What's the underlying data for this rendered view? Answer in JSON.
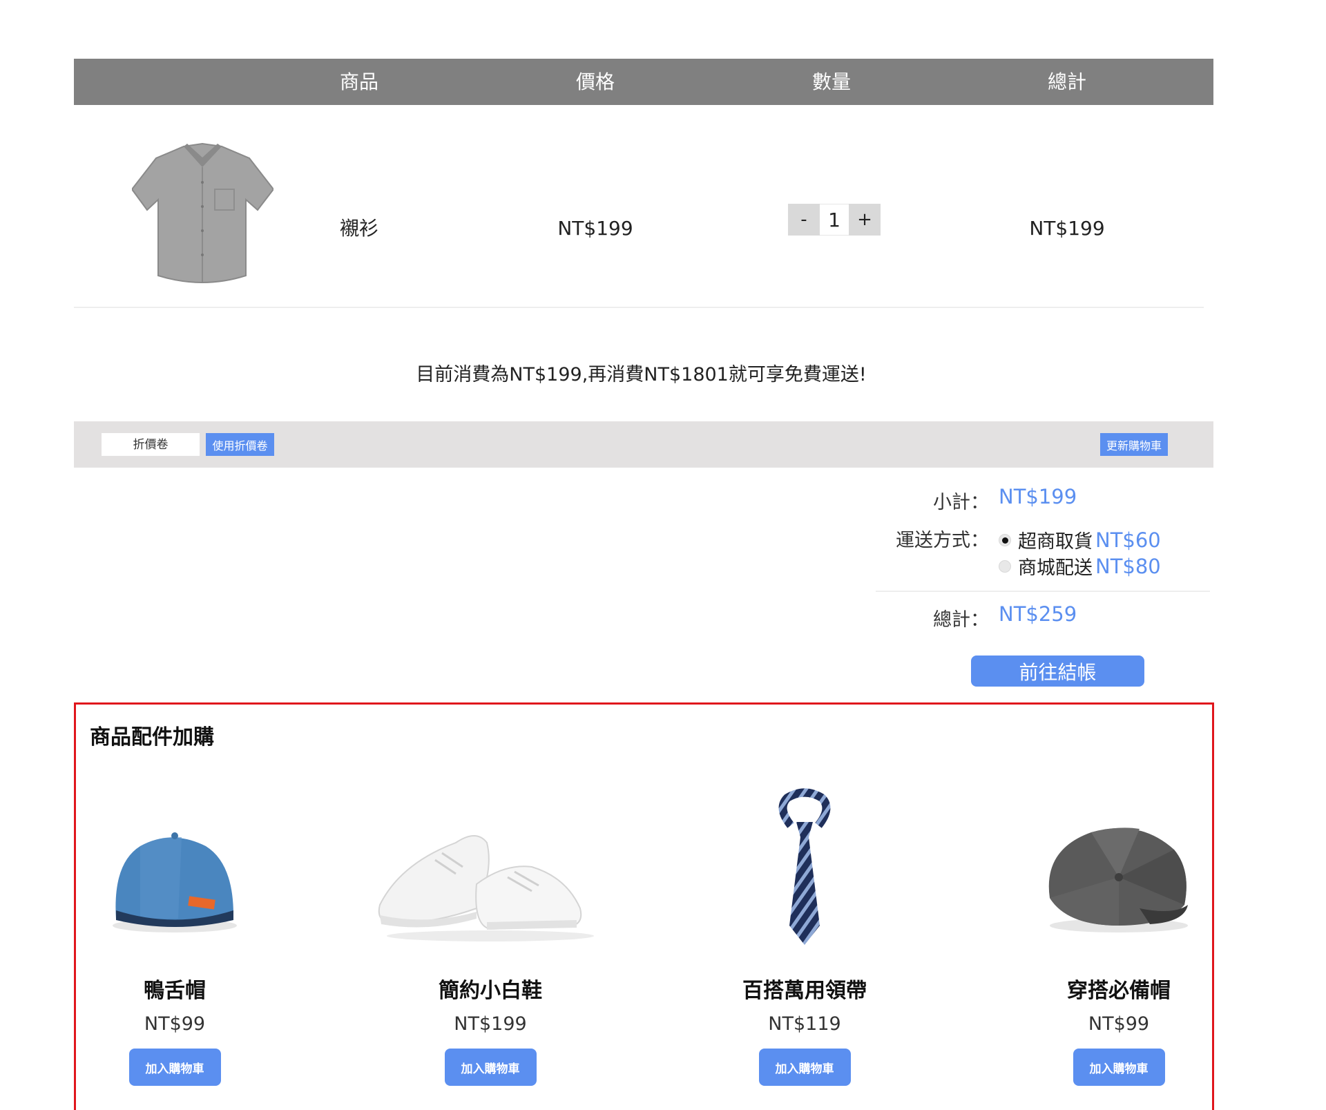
{
  "table": {
    "headers": [
      "商品",
      "價格",
      "數量",
      "總計"
    ],
    "row": {
      "image_icon": "shirt-image",
      "name": "襯衫",
      "price": "NT$199",
      "quantity": "1",
      "minus_label": "-",
      "plus_label": "+",
      "total": "NT$199"
    }
  },
  "notice": "目前消費為NT$199,再消費NT$1801就可享免費運送!",
  "coupon": {
    "placeholder": "折價卷",
    "use_label": "使用折價卷",
    "update_label": "更新購物車"
  },
  "summary": {
    "subtotal_label": "小計：",
    "subtotal_value": "NT$199",
    "shipping_label": "運送方式：",
    "shipping_options": [
      {
        "label": "超商取貨",
        "price": "NT$60",
        "selected": true
      },
      {
        "label": "商城配送",
        "price": "NT$80",
        "selected": false
      }
    ],
    "total_label": "總計：",
    "total_value": "NT$259",
    "checkout_label": "前往結帳"
  },
  "addons": {
    "title": "商品配件加購",
    "items": [
      {
        "name": "鴨舌帽",
        "price": "NT$99",
        "button": "加入購物車",
        "icon": "baseball-cap-image"
      },
      {
        "name": "簡約小白鞋",
        "price": "NT$199",
        "button": "加入購物車",
        "icon": "white-sneakers-image"
      },
      {
        "name": "百搭萬用領帶",
        "price": "NT$119",
        "button": "加入購物車",
        "icon": "necktie-image"
      },
      {
        "name": "穿搭必備帽",
        "price": "NT$99",
        "button": "加入購物車",
        "icon": "newsboy-cap-image"
      }
    ]
  },
  "colors": {
    "header_bg": "#808080",
    "accent_blue": "#5b8ff0",
    "coupon_bar_bg": "#e3e1e1",
    "addon_border": "#e0161c"
  }
}
